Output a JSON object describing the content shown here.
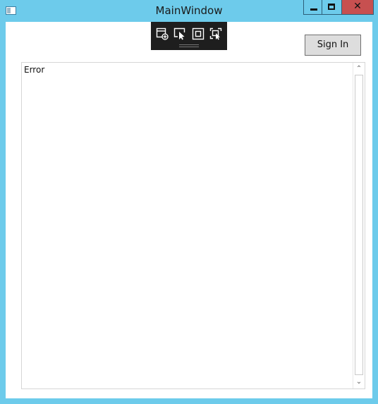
{
  "window": {
    "title": "MainWindow",
    "close_glyph": "✕",
    "frame_color": "#6dcbeb",
    "close_color": "#c75050"
  },
  "debug_toolbar": {
    "icons": [
      "live-visual-tree-icon",
      "select-element-icon",
      "display-layout-adorners-icon",
      "track-focused-element-icon"
    ]
  },
  "signin": {
    "label": "Sign In"
  },
  "output": {
    "text": "Error"
  },
  "scrollbar": {
    "up_glyph": "⌃",
    "down_glyph": "⌄"
  }
}
